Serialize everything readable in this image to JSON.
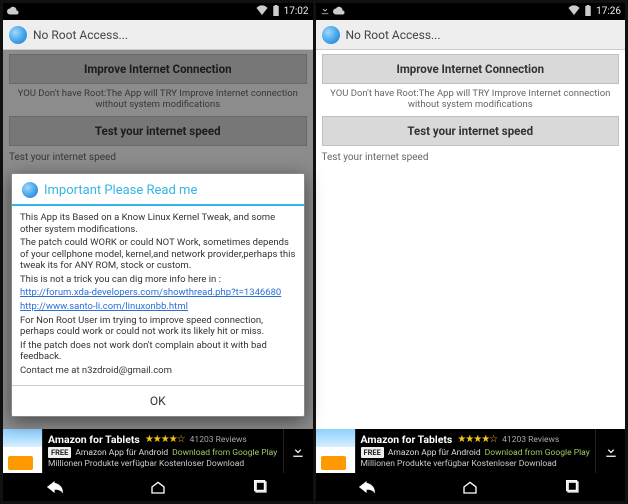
{
  "statusbar": {
    "time_left": "17:02",
    "time_right": "17:26"
  },
  "titlebar": {
    "title": "No Root Access..."
  },
  "content": {
    "btn_improve": "Improve Internet Connection",
    "desc": "YOU Don't have Root:The App will TRY Improve Internet connection without system modifications",
    "btn_test": "Test your internet speed",
    "test_label": "Test your internet speed"
  },
  "dialog": {
    "title": "Important Please Read me",
    "body_l1": "This App its Based on a Know Linux Kernel Tweak, and some other system modifications.",
    "body_l2": "The patch could WORK or could NOT Work, sometimes depends of your cellphone model, kernel,and network provider,perhaps this tweak its for ANY ROM, stock or custom.",
    "body_l3": "This is not a trick you can dig more info here in :",
    "link1": "http://forum.xda-developers.com/showthread.php?t=1346680",
    "link2": "http://www.santo-li.com/linuxonbb.html",
    "body_l4": "For Non Root User im trying to improve speed connection, perhaps could work or could not work its likely hit or miss.",
    "body_l5": "If the patch does not work don't complain about it with bad feedback.",
    "body_l6": "Contact me at n3zdroid@gmail.com",
    "ok": "OK"
  },
  "ad": {
    "brand": "amazon",
    "name": "Amazon for Tablets",
    "stars": "★★★★☆",
    "reviews": "41203 Reviews",
    "free": "FREE",
    "appfor": "Amazon App für Android",
    "gplink": "Download from Google Play",
    "line3": "Millionen Produkte verfügbar Kostenloser Download"
  }
}
